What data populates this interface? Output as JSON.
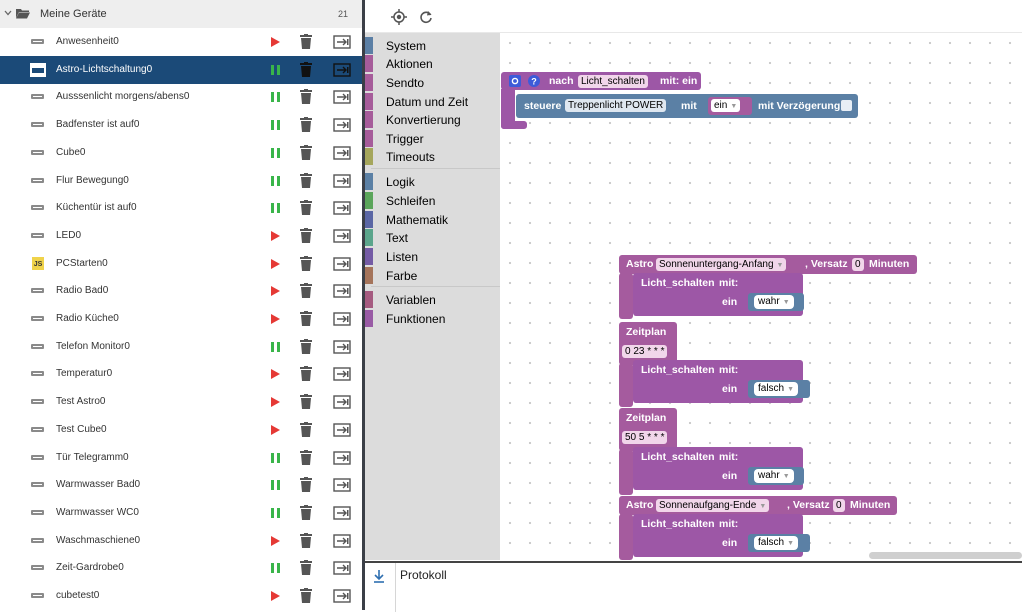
{
  "left": {
    "group": {
      "title": "Meine Geräte",
      "count": "21"
    },
    "scripts": [
      {
        "name": "Anwesenheit0",
        "status": "stopped"
      },
      {
        "name": "Astro-Lichtschaltung0",
        "status": "running",
        "selected": true
      },
      {
        "name": "Ausssenlicht morgens/abens0",
        "status": "running"
      },
      {
        "name": "Badfenster ist auf0",
        "status": "running"
      },
      {
        "name": "Cube0",
        "status": "running"
      },
      {
        "name": "Flur Bewegung0",
        "status": "running"
      },
      {
        "name": "Küchentür ist auf0",
        "status": "running"
      },
      {
        "name": "LED0",
        "status": "stopped"
      },
      {
        "name": "PCStarten0",
        "status": "stopped",
        "icon": "js",
        "icon_label": "JS"
      },
      {
        "name": "Radio Bad0",
        "status": "stopped"
      },
      {
        "name": "Radio Küche0",
        "status": "stopped"
      },
      {
        "name": "Telefon Monitor0",
        "status": "running"
      },
      {
        "name": "Temperatur0",
        "status": "stopped"
      },
      {
        "name": "Test Astro0",
        "status": "stopped"
      },
      {
        "name": "Test Cube0",
        "status": "stopped"
      },
      {
        "name": "Tür Telegramm0",
        "status": "running"
      },
      {
        "name": "Warmwasser Bad0",
        "status": "running"
      },
      {
        "name": "Warmwasser WC0",
        "status": "running"
      },
      {
        "name": "Waschmaschiene0",
        "status": "stopped"
      },
      {
        "name": "Zeit-Gardrobe0",
        "status": "running"
      },
      {
        "name": "cubetest0",
        "status": "stopped"
      }
    ]
  },
  "toolbox": {
    "categories": [
      {
        "label": "System",
        "color": "#5b7fa5"
      },
      {
        "label": "Aktionen",
        "color": "#a65c9a"
      },
      {
        "label": "Sendto",
        "color": "#a65c9a"
      },
      {
        "label": "Datum und Zeit",
        "color": "#a65c9a"
      },
      {
        "label": "Konvertierung",
        "color": "#a65c9a"
      },
      {
        "label": "Trigger",
        "color": "#a65c9a"
      },
      {
        "label": "Timeouts",
        "color": "#a5a65c"
      },
      {
        "label": "Logik",
        "color": "#5b80a5"
      },
      {
        "label": "Schleifen",
        "color": "#5ba55b"
      },
      {
        "label": "Mathematik",
        "color": "#5b67a5"
      },
      {
        "label": "Text",
        "color": "#5ba58c"
      },
      {
        "label": "Listen",
        "color": "#745ba5"
      },
      {
        "label": "Farbe",
        "color": "#a5745b"
      },
      {
        "label": "Variablen",
        "color": "#a55b80"
      },
      {
        "label": "Funktionen",
        "color": "#995ba5"
      }
    ]
  },
  "blocks": {
    "func": {
      "nach": "nach",
      "name": "Licht_schalten",
      "mit": "mit: ein"
    },
    "steuere": {
      "label": "steuere",
      "target": "Treppenlicht POWER",
      "mit": "mit",
      "value": "ein",
      "delay": "mit Verzögerung"
    },
    "astro1": {
      "label": "Astro",
      "event": "Sonnenuntergang-Anfang",
      "versatz": ", Versatz",
      "offset": "0",
      "minuten": "Minuten"
    },
    "call1": {
      "label": "Licht_schalten",
      "mit": "mit:",
      "param": "ein",
      "value": "wahr"
    },
    "zeitplan1": {
      "label": "Zeitplan",
      "cron": "0 23 * * *"
    },
    "call2": {
      "label": "Licht_schalten",
      "mit": "mit:",
      "param": "ein",
      "value": "falsch"
    },
    "zeitplan2": {
      "label": "Zeitplan",
      "cron": "50 5 * * *"
    },
    "call3": {
      "label": "Licht_schalten",
      "mit": "mit:",
      "param": "ein",
      "value": "wahr"
    },
    "astro2": {
      "label": "Astro",
      "event": "Sonnenaufgang-Ende",
      "versatz": ", Versatz",
      "offset": "0",
      "minuten": "Minuten"
    },
    "call4": {
      "label": "Licht_schalten",
      "mit": "mit:",
      "param": "ein",
      "value": "falsch"
    }
  },
  "bottom": {
    "title": "Protokoll"
  }
}
